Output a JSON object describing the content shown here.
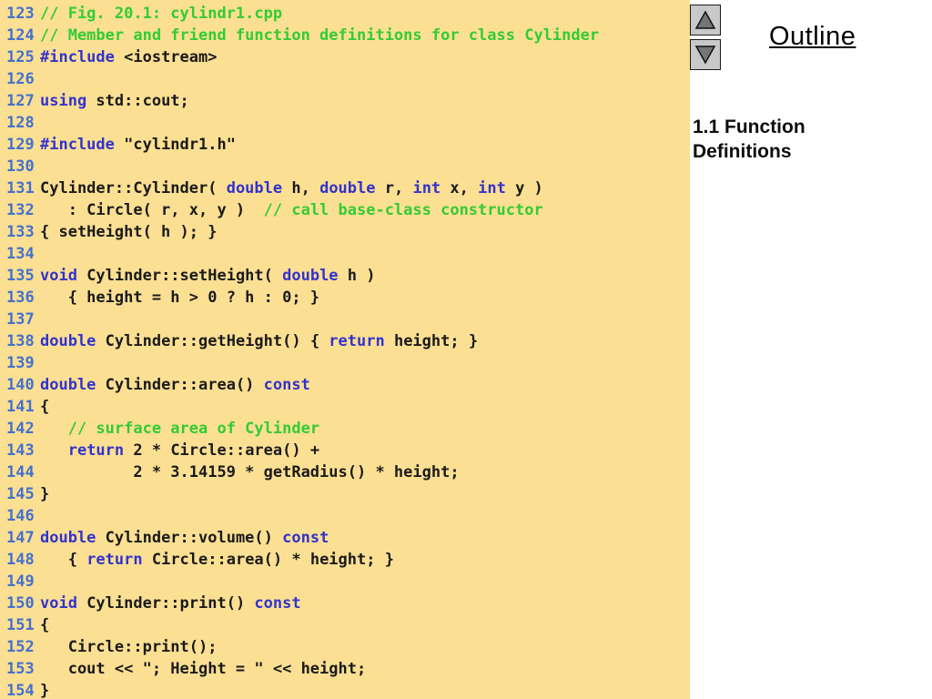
{
  "colors": {
    "tan": "#FBDF93",
    "kw": "#3333CC",
    "ln": "#4470CE",
    "comment": "#33CC33",
    "code": "#1A1A1A",
    "btnbg": "#C8C8C8",
    "tri": "#757575"
  },
  "side": {
    "outline_label": "Outline",
    "section_title": "1.1 Function Definitions",
    "up_icon": "up-triangle",
    "down_icon": "down-triangle"
  },
  "code": {
    "lines": [
      {
        "n": "123",
        "s": [
          {
            "t": "// Fig. 20.1: cylindr1.cpp",
            "c": "comment"
          }
        ]
      },
      {
        "n": "124",
        "s": [
          {
            "t": "// Member and friend function definitions for class Cylinder",
            "c": "comment"
          }
        ]
      },
      {
        "n": "125",
        "s": [
          {
            "t": "#include",
            "c": "keyword"
          },
          {
            "t": " <iostream>",
            "c": "plain"
          }
        ]
      },
      {
        "n": "126",
        "s": []
      },
      {
        "n": "127",
        "s": [
          {
            "t": "using",
            "c": "keyword"
          },
          {
            "t": " std::cout;",
            "c": "plain"
          }
        ]
      },
      {
        "n": "128",
        "s": []
      },
      {
        "n": "129",
        "s": [
          {
            "t": "#include",
            "c": "keyword"
          },
          {
            "t": " \"cylindr1.h\"",
            "c": "plain"
          }
        ]
      },
      {
        "n": "130",
        "s": []
      },
      {
        "n": "131",
        "s": [
          {
            "t": "Cylinder::Cylinder( ",
            "c": "plain"
          },
          {
            "t": "double",
            "c": "keyword"
          },
          {
            "t": " h, ",
            "c": "plain"
          },
          {
            "t": "double",
            "c": "keyword"
          },
          {
            "t": " r, ",
            "c": "plain"
          },
          {
            "t": "int",
            "c": "keyword"
          },
          {
            "t": " x, ",
            "c": "plain"
          },
          {
            "t": "int",
            "c": "keyword"
          },
          {
            "t": " y )",
            "c": "plain"
          }
        ]
      },
      {
        "n": "132",
        "s": [
          {
            "t": "   : Circle( r, x, y )  ",
            "c": "plain"
          },
          {
            "t": "// call base-class constructor",
            "c": "comment"
          }
        ]
      },
      {
        "n": "133",
        "s": [
          {
            "t": "{ setHeight( h ); }",
            "c": "plain"
          }
        ]
      },
      {
        "n": "134",
        "s": []
      },
      {
        "n": "135",
        "s": [
          {
            "t": "void",
            "c": "keyword"
          },
          {
            "t": " Cylinder::setHeight( ",
            "c": "plain"
          },
          {
            "t": "double",
            "c": "keyword"
          },
          {
            "t": " h )",
            "c": "plain"
          }
        ]
      },
      {
        "n": "136",
        "s": [
          {
            "t": "   { height = h > 0 ? h : 0; }",
            "c": "plain"
          }
        ]
      },
      {
        "n": "137",
        "s": []
      },
      {
        "n": "138",
        "s": [
          {
            "t": "double",
            "c": "keyword"
          },
          {
            "t": " Cylinder::getHeight() { ",
            "c": "plain"
          },
          {
            "t": "return",
            "c": "keyword"
          },
          {
            "t": " height; }",
            "c": "plain"
          }
        ]
      },
      {
        "n": "139",
        "s": []
      },
      {
        "n": "140",
        "s": [
          {
            "t": "double",
            "c": "keyword"
          },
          {
            "t": " Cylinder::area() ",
            "c": "plain"
          },
          {
            "t": "const",
            "c": "keyword"
          }
        ]
      },
      {
        "n": "141",
        "s": [
          {
            "t": "{",
            "c": "plain"
          }
        ]
      },
      {
        "n": "142",
        "s": [
          {
            "t": "   ",
            "c": "plain"
          },
          {
            "t": "// surface area of Cylinder",
            "c": "comment"
          }
        ]
      },
      {
        "n": "143",
        "s": [
          {
            "t": "   ",
            "c": "plain"
          },
          {
            "t": "return",
            "c": "keyword"
          },
          {
            "t": " 2 * Circle::area() +",
            "c": "plain"
          }
        ]
      },
      {
        "n": "144",
        "s": [
          {
            "t": "          2 * 3.14159 * getRadius() * height;",
            "c": "plain"
          }
        ]
      },
      {
        "n": "145",
        "s": [
          {
            "t": "}",
            "c": "plain"
          }
        ]
      },
      {
        "n": "146",
        "s": []
      },
      {
        "n": "147",
        "s": [
          {
            "t": "double",
            "c": "keyword"
          },
          {
            "t": " Cylinder::volume() ",
            "c": "plain"
          },
          {
            "t": "const",
            "c": "keyword"
          }
        ]
      },
      {
        "n": "148",
        "s": [
          {
            "t": "   { ",
            "c": "plain"
          },
          {
            "t": "return",
            "c": "keyword"
          },
          {
            "t": " Circle::area() * height; }",
            "c": "plain"
          }
        ]
      },
      {
        "n": "149",
        "s": []
      },
      {
        "n": "150",
        "s": [
          {
            "t": "void",
            "c": "keyword"
          },
          {
            "t": " Cylinder::print() ",
            "c": "plain"
          },
          {
            "t": "const",
            "c": "keyword"
          }
        ]
      },
      {
        "n": "151",
        "s": [
          {
            "t": "{",
            "c": "plain"
          }
        ]
      },
      {
        "n": "152",
        "s": [
          {
            "t": "   Circle::print();",
            "c": "plain"
          }
        ]
      },
      {
        "n": "153",
        "s": [
          {
            "t": "   cout << \"; Height = \" << height;",
            "c": "plain"
          }
        ]
      },
      {
        "n": "154",
        "s": [
          {
            "t": "}",
            "c": "plain"
          }
        ]
      }
    ]
  }
}
